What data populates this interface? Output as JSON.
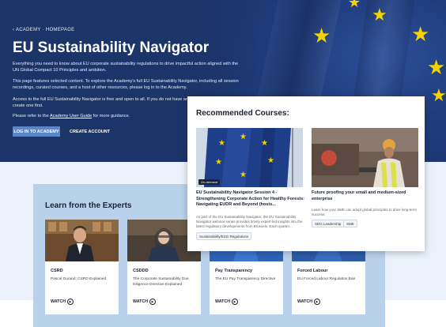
{
  "hero": {
    "breadcrumb": "‹ ACADEMY · HOMEPAGE",
    "title": "EU Sustainability Navigator",
    "paragraph1": "Everything you need to know about EU corporate sustainability regulations to drive impactful action aligned with the UN Global Compact 10 Principles and ambition.",
    "paragraph2": "This page features selected content. To explore the Academy's full EU Sustainability Navigator, including all session recordings, curated courses, and a host of other resources, please log in to the Academy.",
    "paragraph3": "Access to the full EU Sustainability Navigator is free and open to all. If you do not have an Academy account, simply create one first.",
    "paragraph4_prefix": "Please refer to the ",
    "paragraph4_link": "Academy User Guide",
    "paragraph4_suffix": " for more guidance.",
    "login_button": "LOG IN TO ACADEMY",
    "create_account_button": "CREATE ACCOUNT",
    "colors": {
      "navy": "#1d3a72",
      "button": "#5b86c9",
      "star": "#f5d300"
    }
  },
  "recommended": {
    "title": "Recommended Courses:",
    "courses": [
      {
        "badge": "On-demand",
        "title": "EU Sustainability Navigator Session 4 - Strengthening Corporate Action for Healthy Forests: Navigating EUDR and Beyond (hosts...",
        "description": "As part of the EU Sustainability Navigator, the EU Sustainability Navigator webinar series provides timely expert-led insights into the latest regulatory developments from Brussels. Each quarter...",
        "tags": [
          "Sustainability/ESG Regulations"
        ]
      },
      {
        "badge": "",
        "title": "Future proofing your small and medium-sized enterprise",
        "description": "Learn how your SME can adopt global principles to drive long-term success.",
        "tags": [
          "SDG Leadership",
          "SME"
        ]
      }
    ]
  },
  "experts": {
    "title": "Learn from the Experts",
    "watch_label": "WATCH",
    "cards": [
      {
        "title": "CSRD",
        "subtitle": "Pascal Durand: CSRD Explained"
      },
      {
        "title": "CSDDD",
        "subtitle": "The Corporate Sustainability Due Diligence Directive Explained"
      },
      {
        "title": "Pay Transparency",
        "subtitle": "The EU Pay Transparency Directive"
      },
      {
        "title": "Forced Labour",
        "subtitle": "EU Forced Labour Regulation Ban"
      }
    ]
  }
}
